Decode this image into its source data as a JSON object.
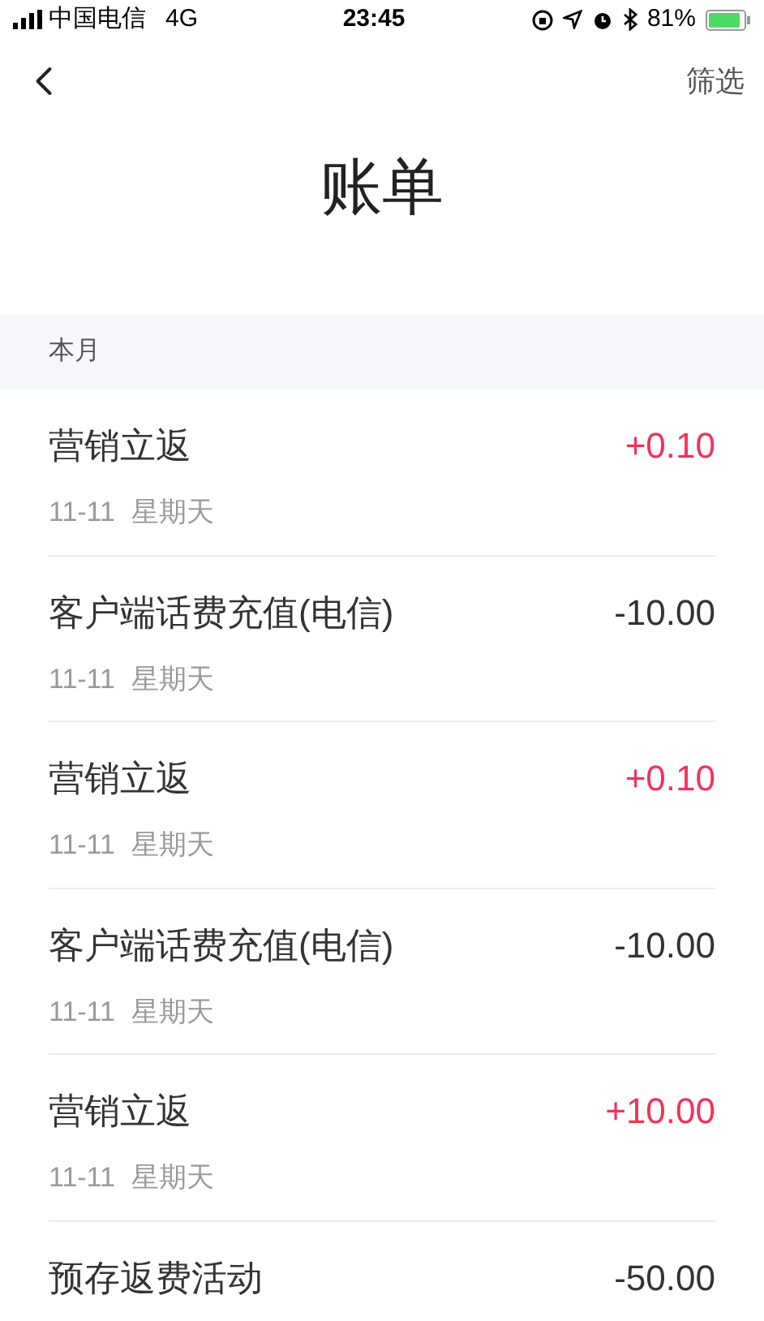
{
  "status_bar": {
    "carrier": "中国电信",
    "network": "4G",
    "time": "23:45",
    "battery": "81%"
  },
  "nav": {
    "filter": "筛选"
  },
  "title": "账单",
  "section": {
    "label": "本月"
  },
  "bills": [
    {
      "name": "营销立返",
      "date": "11-11",
      "weekday": "星期天",
      "amount": "+0.10",
      "kind": "income"
    },
    {
      "name": "客户端话费充值(电信)",
      "date": "11-11",
      "weekday": "星期天",
      "amount": "-10.00",
      "kind": "expense"
    },
    {
      "name": "营销立返",
      "date": "11-11",
      "weekday": "星期天",
      "amount": "+0.10",
      "kind": "income"
    },
    {
      "name": "客户端话费充值(电信)",
      "date": "11-11",
      "weekday": "星期天",
      "amount": "-10.00",
      "kind": "expense"
    },
    {
      "name": "营销立返",
      "date": "11-11",
      "weekday": "星期天",
      "amount": "+10.00",
      "kind": "income"
    },
    {
      "name": "预存返费活动",
      "amount": "-50.00",
      "kind": "expense"
    }
  ]
}
